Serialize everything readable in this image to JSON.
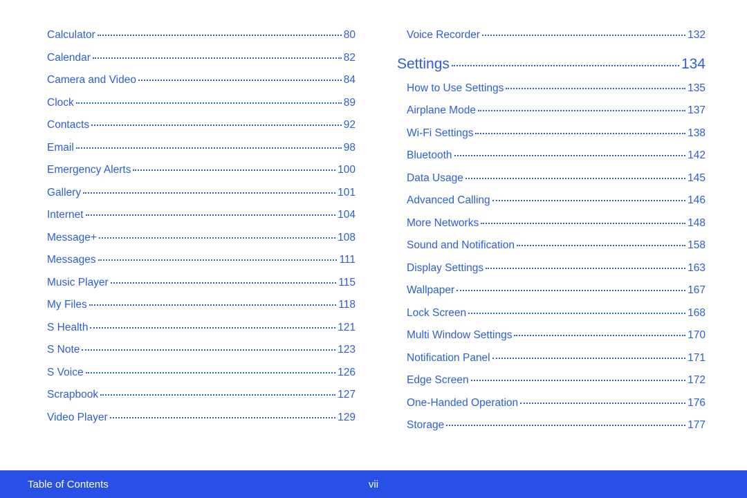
{
  "footer": {
    "title": "Table of Contents",
    "page": "vii"
  },
  "left_column": [
    {
      "label": "Calculator",
      "page": "80",
      "type": "item"
    },
    {
      "label": "Calendar",
      "page": "82",
      "type": "item"
    },
    {
      "label": "Camera and Video",
      "page": "84",
      "type": "item"
    },
    {
      "label": "Clock",
      "page": "89",
      "type": "item"
    },
    {
      "label": "Contacts",
      "page": "92",
      "type": "item"
    },
    {
      "label": "Email",
      "page": "98",
      "type": "item"
    },
    {
      "label": "Emergency Alerts",
      "page": "100",
      "type": "item"
    },
    {
      "label": "Gallery",
      "page": "101",
      "type": "item"
    },
    {
      "label": "Internet",
      "page": "104",
      "type": "item"
    },
    {
      "label": "Message+",
      "page": "108",
      "type": "item"
    },
    {
      "label": "Messages",
      "page": "111",
      "type": "item"
    },
    {
      "label": "Music Player",
      "page": "115",
      "type": "item"
    },
    {
      "label": "My Files",
      "page": "118",
      "type": "item"
    },
    {
      "label": "S Health",
      "page": "121",
      "type": "item"
    },
    {
      "label": "S Note",
      "page": "123",
      "type": "item"
    },
    {
      "label": "S Voice",
      "page": "126",
      "type": "item"
    },
    {
      "label": "Scrapbook",
      "page": "127",
      "type": "item"
    },
    {
      "label": "Video Player",
      "page": "129",
      "type": "item"
    }
  ],
  "right_column": [
    {
      "label": "Voice Recorder",
      "page": "132",
      "type": "sub"
    },
    {
      "label": "Settings",
      "page": "134",
      "type": "heading"
    },
    {
      "label": "How to Use Settings",
      "page": "135",
      "type": "sub"
    },
    {
      "label": "Airplane Mode",
      "page": "137",
      "type": "sub"
    },
    {
      "label": "Wi-Fi Settings",
      "page": "138",
      "type": "sub"
    },
    {
      "label": "Bluetooth",
      "page": "142",
      "type": "sub"
    },
    {
      "label": "Data Usage",
      "page": "145",
      "type": "sub"
    },
    {
      "label": "Advanced Calling",
      "page": "146",
      "type": "sub"
    },
    {
      "label": "More Networks",
      "page": "148",
      "type": "sub"
    },
    {
      "label": "Sound and Notification",
      "page": "158",
      "type": "sub"
    },
    {
      "label": "Display Settings",
      "page": "163",
      "type": "sub"
    },
    {
      "label": "Wallpaper",
      "page": "167",
      "type": "sub"
    },
    {
      "label": "Lock Screen",
      "page": "168",
      "type": "sub"
    },
    {
      "label": "Multi Window Settings",
      "page": "170",
      "type": "sub"
    },
    {
      "label": "Notification Panel",
      "page": "171",
      "type": "sub"
    },
    {
      "label": "Edge Screen",
      "page": "172",
      "type": "sub"
    },
    {
      "label": "One-Handed Operation",
      "page": "176",
      "type": "sub"
    },
    {
      "label": "Storage",
      "page": "177",
      "type": "sub"
    }
  ]
}
